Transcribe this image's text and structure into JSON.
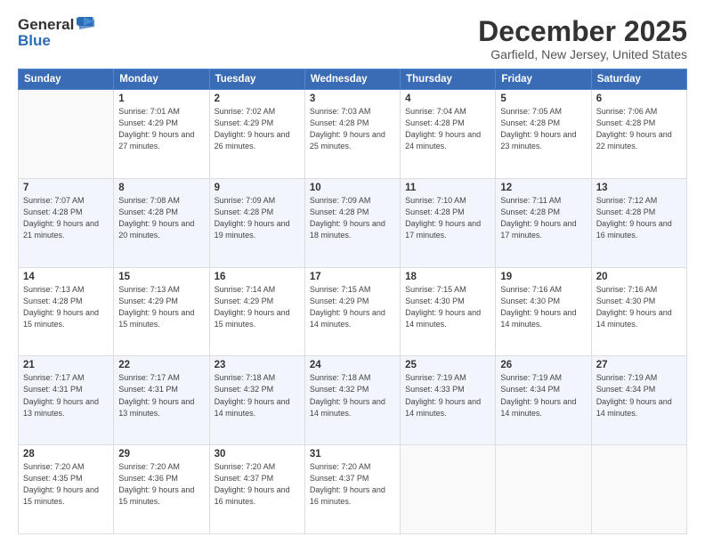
{
  "logo": {
    "general": "General",
    "blue": "Blue"
  },
  "title": "December 2025",
  "subtitle": "Garfield, New Jersey, United States",
  "days_header": [
    "Sunday",
    "Monday",
    "Tuesday",
    "Wednesday",
    "Thursday",
    "Friday",
    "Saturday"
  ],
  "weeks": [
    [
      {
        "num": "",
        "sunrise": "",
        "sunset": "",
        "daylight": ""
      },
      {
        "num": "1",
        "sunrise": "Sunrise: 7:01 AM",
        "sunset": "Sunset: 4:29 PM",
        "daylight": "Daylight: 9 hours and 27 minutes."
      },
      {
        "num": "2",
        "sunrise": "Sunrise: 7:02 AM",
        "sunset": "Sunset: 4:29 PM",
        "daylight": "Daylight: 9 hours and 26 minutes."
      },
      {
        "num": "3",
        "sunrise": "Sunrise: 7:03 AM",
        "sunset": "Sunset: 4:28 PM",
        "daylight": "Daylight: 9 hours and 25 minutes."
      },
      {
        "num": "4",
        "sunrise": "Sunrise: 7:04 AM",
        "sunset": "Sunset: 4:28 PM",
        "daylight": "Daylight: 9 hours and 24 minutes."
      },
      {
        "num": "5",
        "sunrise": "Sunrise: 7:05 AM",
        "sunset": "Sunset: 4:28 PM",
        "daylight": "Daylight: 9 hours and 23 minutes."
      },
      {
        "num": "6",
        "sunrise": "Sunrise: 7:06 AM",
        "sunset": "Sunset: 4:28 PM",
        "daylight": "Daylight: 9 hours and 22 minutes."
      }
    ],
    [
      {
        "num": "7",
        "sunrise": "Sunrise: 7:07 AM",
        "sunset": "Sunset: 4:28 PM",
        "daylight": "Daylight: 9 hours and 21 minutes."
      },
      {
        "num": "8",
        "sunrise": "Sunrise: 7:08 AM",
        "sunset": "Sunset: 4:28 PM",
        "daylight": "Daylight: 9 hours and 20 minutes."
      },
      {
        "num": "9",
        "sunrise": "Sunrise: 7:09 AM",
        "sunset": "Sunset: 4:28 PM",
        "daylight": "Daylight: 9 hours and 19 minutes."
      },
      {
        "num": "10",
        "sunrise": "Sunrise: 7:09 AM",
        "sunset": "Sunset: 4:28 PM",
        "daylight": "Daylight: 9 hours and 18 minutes."
      },
      {
        "num": "11",
        "sunrise": "Sunrise: 7:10 AM",
        "sunset": "Sunset: 4:28 PM",
        "daylight": "Daylight: 9 hours and 17 minutes."
      },
      {
        "num": "12",
        "sunrise": "Sunrise: 7:11 AM",
        "sunset": "Sunset: 4:28 PM",
        "daylight": "Daylight: 9 hours and 17 minutes."
      },
      {
        "num": "13",
        "sunrise": "Sunrise: 7:12 AM",
        "sunset": "Sunset: 4:28 PM",
        "daylight": "Daylight: 9 hours and 16 minutes."
      }
    ],
    [
      {
        "num": "14",
        "sunrise": "Sunrise: 7:13 AM",
        "sunset": "Sunset: 4:28 PM",
        "daylight": "Daylight: 9 hours and 15 minutes."
      },
      {
        "num": "15",
        "sunrise": "Sunrise: 7:13 AM",
        "sunset": "Sunset: 4:29 PM",
        "daylight": "Daylight: 9 hours and 15 minutes."
      },
      {
        "num": "16",
        "sunrise": "Sunrise: 7:14 AM",
        "sunset": "Sunset: 4:29 PM",
        "daylight": "Daylight: 9 hours and 15 minutes."
      },
      {
        "num": "17",
        "sunrise": "Sunrise: 7:15 AM",
        "sunset": "Sunset: 4:29 PM",
        "daylight": "Daylight: 9 hours and 14 minutes."
      },
      {
        "num": "18",
        "sunrise": "Sunrise: 7:15 AM",
        "sunset": "Sunset: 4:30 PM",
        "daylight": "Daylight: 9 hours and 14 minutes."
      },
      {
        "num": "19",
        "sunrise": "Sunrise: 7:16 AM",
        "sunset": "Sunset: 4:30 PM",
        "daylight": "Daylight: 9 hours and 14 minutes."
      },
      {
        "num": "20",
        "sunrise": "Sunrise: 7:16 AM",
        "sunset": "Sunset: 4:30 PM",
        "daylight": "Daylight: 9 hours and 14 minutes."
      }
    ],
    [
      {
        "num": "21",
        "sunrise": "Sunrise: 7:17 AM",
        "sunset": "Sunset: 4:31 PM",
        "daylight": "Daylight: 9 hours and 13 minutes."
      },
      {
        "num": "22",
        "sunrise": "Sunrise: 7:17 AM",
        "sunset": "Sunset: 4:31 PM",
        "daylight": "Daylight: 9 hours and 13 minutes."
      },
      {
        "num": "23",
        "sunrise": "Sunrise: 7:18 AM",
        "sunset": "Sunset: 4:32 PM",
        "daylight": "Daylight: 9 hours and 14 minutes."
      },
      {
        "num": "24",
        "sunrise": "Sunrise: 7:18 AM",
        "sunset": "Sunset: 4:32 PM",
        "daylight": "Daylight: 9 hours and 14 minutes."
      },
      {
        "num": "25",
        "sunrise": "Sunrise: 7:19 AM",
        "sunset": "Sunset: 4:33 PM",
        "daylight": "Daylight: 9 hours and 14 minutes."
      },
      {
        "num": "26",
        "sunrise": "Sunrise: 7:19 AM",
        "sunset": "Sunset: 4:34 PM",
        "daylight": "Daylight: 9 hours and 14 minutes."
      },
      {
        "num": "27",
        "sunrise": "Sunrise: 7:19 AM",
        "sunset": "Sunset: 4:34 PM",
        "daylight": "Daylight: 9 hours and 14 minutes."
      }
    ],
    [
      {
        "num": "28",
        "sunrise": "Sunrise: 7:20 AM",
        "sunset": "Sunset: 4:35 PM",
        "daylight": "Daylight: 9 hours and 15 minutes."
      },
      {
        "num": "29",
        "sunrise": "Sunrise: 7:20 AM",
        "sunset": "Sunset: 4:36 PM",
        "daylight": "Daylight: 9 hours and 15 minutes."
      },
      {
        "num": "30",
        "sunrise": "Sunrise: 7:20 AM",
        "sunset": "Sunset: 4:37 PM",
        "daylight": "Daylight: 9 hours and 16 minutes."
      },
      {
        "num": "31",
        "sunrise": "Sunrise: 7:20 AM",
        "sunset": "Sunset: 4:37 PM",
        "daylight": "Daylight: 9 hours and 16 minutes."
      },
      {
        "num": "",
        "sunrise": "",
        "sunset": "",
        "daylight": ""
      },
      {
        "num": "",
        "sunrise": "",
        "sunset": "",
        "daylight": ""
      },
      {
        "num": "",
        "sunrise": "",
        "sunset": "",
        "daylight": ""
      }
    ]
  ]
}
